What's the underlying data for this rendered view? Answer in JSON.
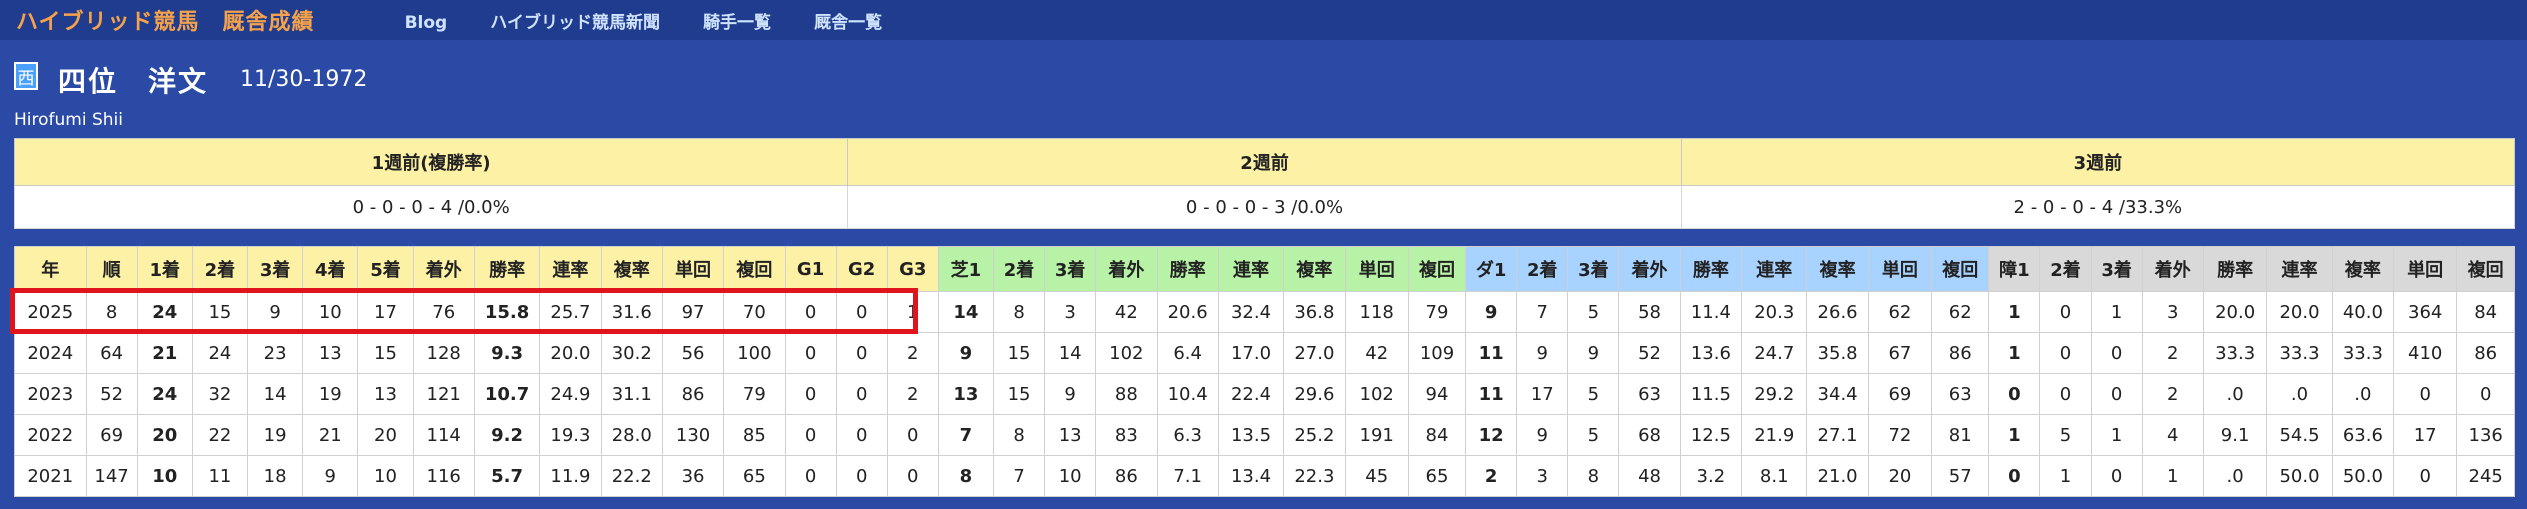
{
  "nav": {
    "brand": "ハイブリッド競馬　厩舎成績",
    "links": [
      "Blog",
      "ハイブリッド競馬新聞",
      "騎手一覧",
      "厩舎一覧"
    ]
  },
  "trainer": {
    "region_badge": "西",
    "name": "四位　洋文",
    "dob": "11/30-1972",
    "roman": "Hirofumi Shii"
  },
  "weekly": {
    "headers": [
      "1週前(複勝率)",
      "2週前",
      "3週前"
    ],
    "values": [
      "0 - 0 - 0 - 4 /0.0%",
      "0 - 0 - 0 - 3 /0.0%",
      "2 - 0 - 0 - 4 /33.3%"
    ]
  },
  "stats": {
    "headers": [
      "年",
      "順",
      "1着",
      "2着",
      "3着",
      "4着",
      "5着",
      "着外",
      "勝率",
      "連率",
      "複率",
      "単回",
      "複回",
      "G1",
      "G2",
      "G3",
      "芝1",
      "2着",
      "3着",
      "着外",
      "勝率",
      "連率",
      "複率",
      "単回",
      "複回",
      "ダ1",
      "2着",
      "3着",
      "着外",
      "勝率",
      "連率",
      "複率",
      "単回",
      "複回",
      "障1",
      "2着",
      "3着",
      "着外",
      "勝率",
      "連率",
      "複率",
      "単回",
      "複回"
    ],
    "rows": [
      [
        "2025",
        "8",
        "24",
        "15",
        "9",
        "10",
        "17",
        "76",
        "15.8",
        "25.7",
        "31.6",
        "97",
        "70",
        "0",
        "0",
        "1",
        "14",
        "8",
        "3",
        "42",
        "20.6",
        "32.4",
        "36.8",
        "118",
        "79",
        "9",
        "7",
        "5",
        "58",
        "11.4",
        "20.3",
        "26.6",
        "62",
        "62",
        "1",
        "0",
        "1",
        "3",
        "20.0",
        "20.0",
        "40.0",
        "364",
        "84"
      ],
      [
        "2024",
        "64",
        "21",
        "24",
        "23",
        "13",
        "15",
        "128",
        "9.3",
        "20.0",
        "30.2",
        "56",
        "100",
        "0",
        "0",
        "2",
        "9",
        "15",
        "14",
        "102",
        "6.4",
        "17.0",
        "27.0",
        "42",
        "109",
        "11",
        "9",
        "9",
        "52",
        "13.6",
        "24.7",
        "35.8",
        "67",
        "86",
        "1",
        "0",
        "0",
        "2",
        "33.3",
        "33.3",
        "33.3",
        "410",
        "86"
      ],
      [
        "2023",
        "52",
        "24",
        "32",
        "14",
        "19",
        "13",
        "121",
        "10.7",
        "24.9",
        "31.1",
        "86",
        "79",
        "0",
        "0",
        "2",
        "13",
        "15",
        "9",
        "88",
        "10.4",
        "22.4",
        "29.6",
        "102",
        "94",
        "11",
        "17",
        "5",
        "63",
        "11.5",
        "29.2",
        "34.4",
        "69",
        "63",
        "0",
        "0",
        "0",
        "2",
        ".0",
        ".0",
        ".0",
        "0",
        "0"
      ],
      [
        "2022",
        "69",
        "20",
        "22",
        "19",
        "21",
        "20",
        "114",
        "9.2",
        "19.3",
        "28.0",
        "130",
        "85",
        "0",
        "0",
        "0",
        "7",
        "8",
        "13",
        "83",
        "6.3",
        "13.5",
        "25.2",
        "191",
        "84",
        "12",
        "9",
        "5",
        "68",
        "12.5",
        "21.9",
        "27.1",
        "72",
        "81",
        "1",
        "5",
        "1",
        "4",
        "9.1",
        "54.5",
        "63.6",
        "17",
        "136"
      ],
      [
        "2021",
        "147",
        "10",
        "11",
        "18",
        "9",
        "10",
        "116",
        "5.7",
        "11.9",
        "22.2",
        "36",
        "65",
        "0",
        "0",
        "0",
        "8",
        "7",
        "10",
        "86",
        "7.1",
        "13.4",
        "22.3",
        "45",
        "65",
        "2",
        "3",
        "8",
        "48",
        "3.2",
        "8.1",
        "21.0",
        "20",
        "57",
        "0",
        "1",
        "0",
        "1",
        ".0",
        "50.0",
        "50.0",
        "0",
        "245"
      ]
    ]
  }
}
